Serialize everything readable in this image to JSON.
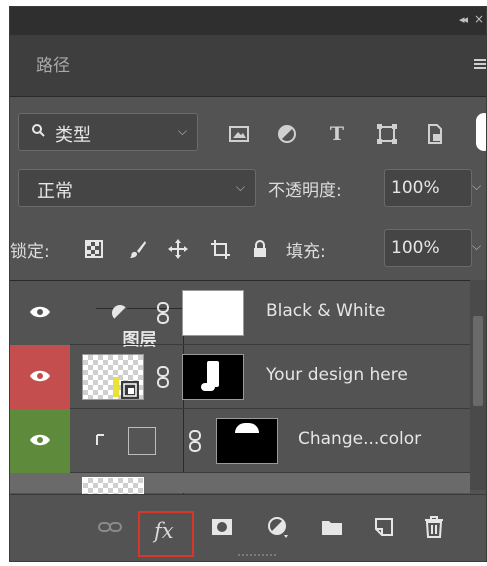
{
  "titlebar": {
    "collapse_glyph": "◂◂",
    "close_glyph": "×"
  },
  "tabs": [
    {
      "label": "路径",
      "active": false
    },
    {
      "label": "图层",
      "active": true
    }
  ],
  "panel_menu_icon": "hamburger-menu-icon",
  "filter": {
    "label": "类型",
    "icons": [
      "image-filter-icon",
      "adjustment-filter-icon",
      "type-filter-icon",
      "shape-filter-icon",
      "smart-object-filter-icon"
    ],
    "type_glyph": "T"
  },
  "blend": {
    "mode": "正常",
    "opacity_label": "不透明度:",
    "opacity_value": "100%"
  },
  "lock": {
    "label": "锁定:",
    "icons": [
      "lock-transparent-pixels-icon",
      "lock-image-pixels-icon",
      "lock-position-icon",
      "lock-artboard-icon",
      "lock-all-icon"
    ],
    "fill_label": "填充:",
    "fill_value": "100%"
  },
  "layers": [
    {
      "name": "Black & White",
      "eye_bg": "#535353",
      "type": "adjustment"
    },
    {
      "name": "Your design here",
      "eye_bg": "#c44d4d",
      "type": "smart-object"
    },
    {
      "name": "Change...color",
      "eye_bg": "#5e8a3c",
      "type": "clipped-solid"
    },
    {
      "name": "",
      "eye_bg": "#535353",
      "type": "partial"
    }
  ],
  "bottom_tools": {
    "fx_label": "fx",
    "icons": [
      "link-layers-icon",
      "fx-icon",
      "add-mask-icon",
      "new-adjustment-icon",
      "new-group-icon",
      "new-layer-icon",
      "delete-layer-icon"
    ]
  },
  "colors": {
    "highlight": "#d9362b",
    "red_label": "#c44d4d",
    "green_label": "#5e8a3c"
  }
}
